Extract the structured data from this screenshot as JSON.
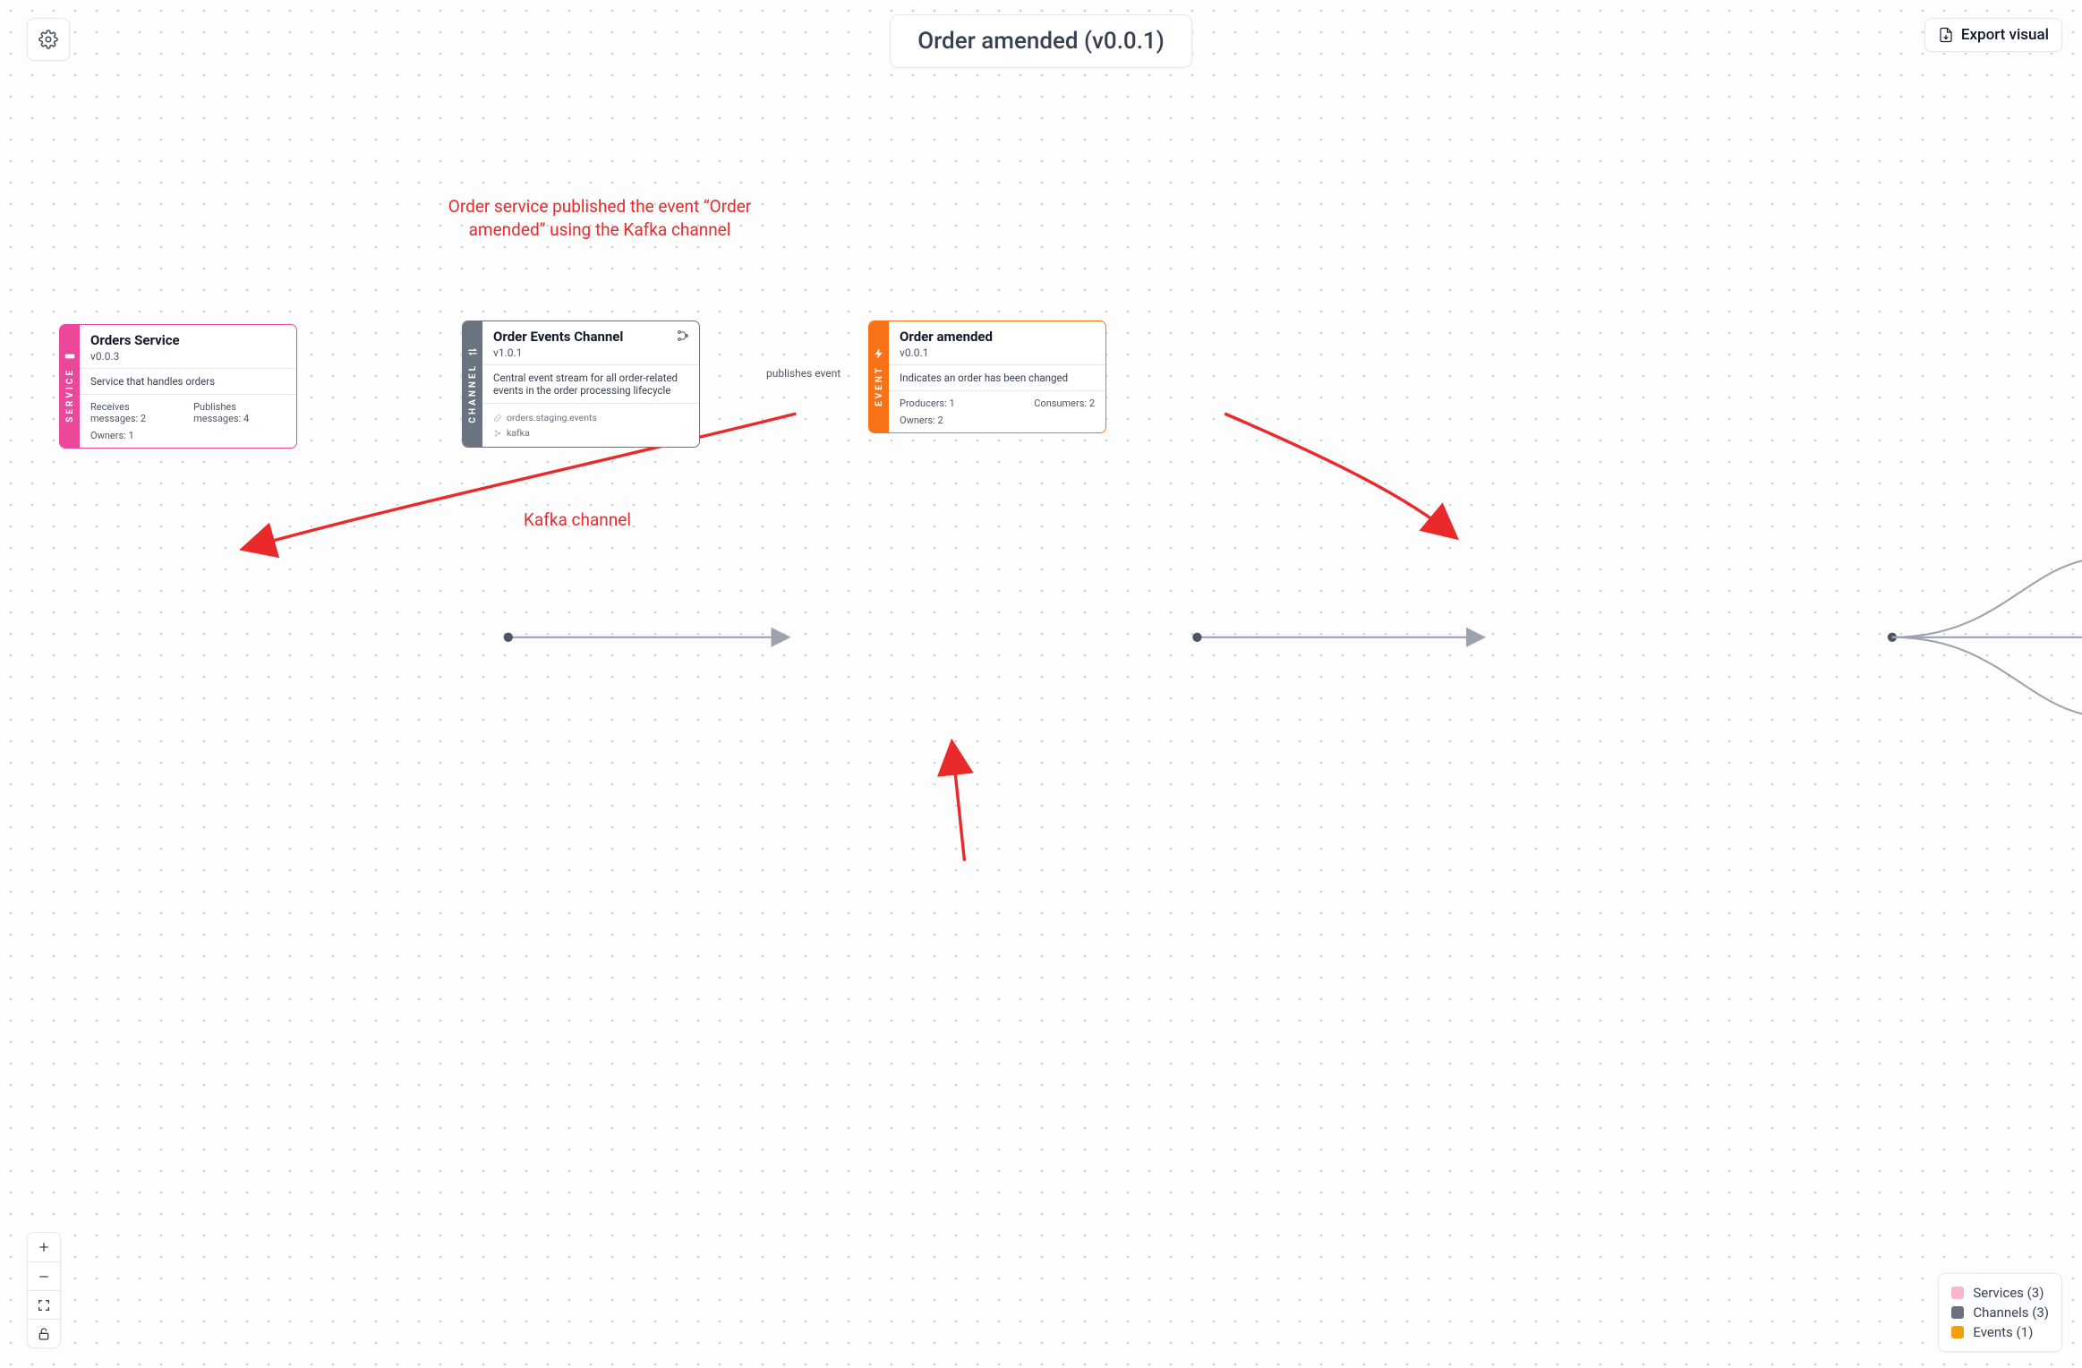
{
  "header": {
    "title": "Order amended (v0.0.1)",
    "export_label": "Export visual"
  },
  "annotations": {
    "top": "Order service published the event “Order amended” using the Kafka channel",
    "bottom": "Kafka channel"
  },
  "edges": {
    "publish_label": "publishes event"
  },
  "nodes": {
    "service": {
      "tab": "SERVICE",
      "title": "Orders Service",
      "version": "v0.0.3",
      "description": "Service that handles orders",
      "stat1_label": "Receives messages:",
      "stat1_value": "2",
      "stat2_label": "Publishes messages:",
      "stat2_value": "4",
      "owners_label": "Owners:",
      "owners_value": "1"
    },
    "channel": {
      "tab": "CHANNEL",
      "title": "Order Events Channel",
      "version": "v1.0.1",
      "description": "Central event stream for all order-related events in the order processing lifecycle",
      "topic": "orders.staging.events",
      "broker": "kafka"
    },
    "event": {
      "tab": "EVENT",
      "title": "Order amended",
      "version": "v0.0.1",
      "description": "Indicates an order has been changed",
      "stat1_label": "Producers:",
      "stat1_value": "1",
      "stat2_label": "Consumers:",
      "stat2_value": "2",
      "owners_label": "Owners:",
      "owners_value": "2"
    }
  },
  "legend": {
    "services": {
      "label": "Services",
      "count": "3",
      "color": "#fbb6ce"
    },
    "channels": {
      "label": "Channels",
      "count": "3",
      "color": "#6b7280"
    },
    "events": {
      "label": "Events",
      "count": "1",
      "color": "#f59e0b"
    }
  },
  "colors": {
    "service": "#ec4899",
    "channel": "#6b7280",
    "event": "#f97316",
    "annotation": "#ea2a2a"
  }
}
